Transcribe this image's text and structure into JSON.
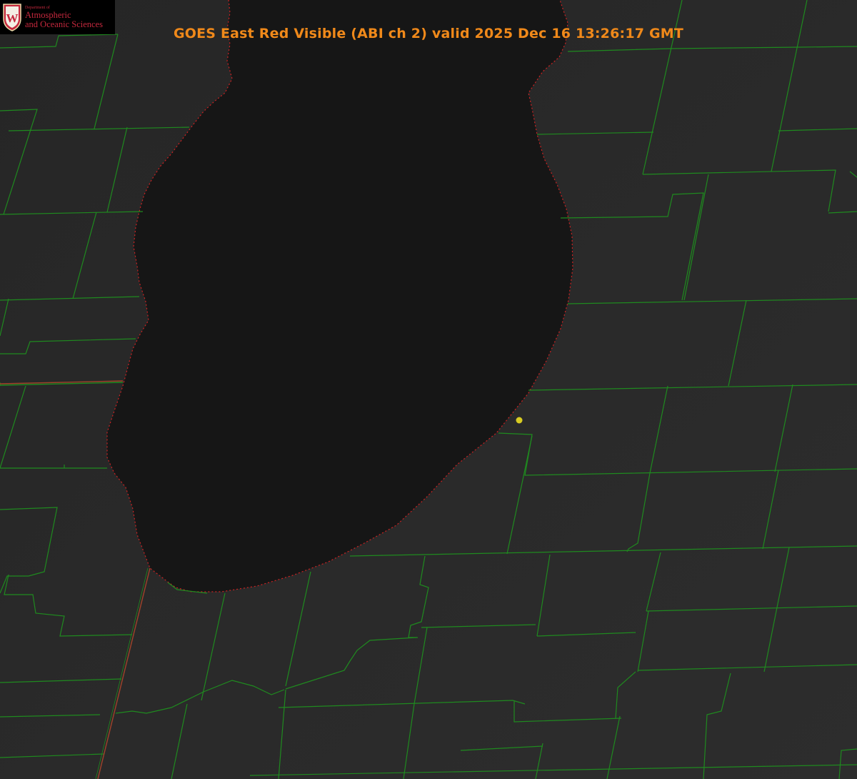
{
  "title": "GOES East Red Visible (ABI ch 2) valid 2025 Dec 16 13:26:17 GMT",
  "logo": {
    "department_text": "Department of",
    "line1": "Atmospheric",
    "line2": "and Oceanic Sciences",
    "crest_letter": "W"
  },
  "colors": {
    "title": "#f0891a",
    "county_lines": "#1f8a1f",
    "state_line": "#a0432a",
    "lake_outline": "#cc2222",
    "marker": "#d8cc22",
    "lake": "#161616",
    "land": "#282828"
  },
  "marker_icon": "location-dot-icon"
}
